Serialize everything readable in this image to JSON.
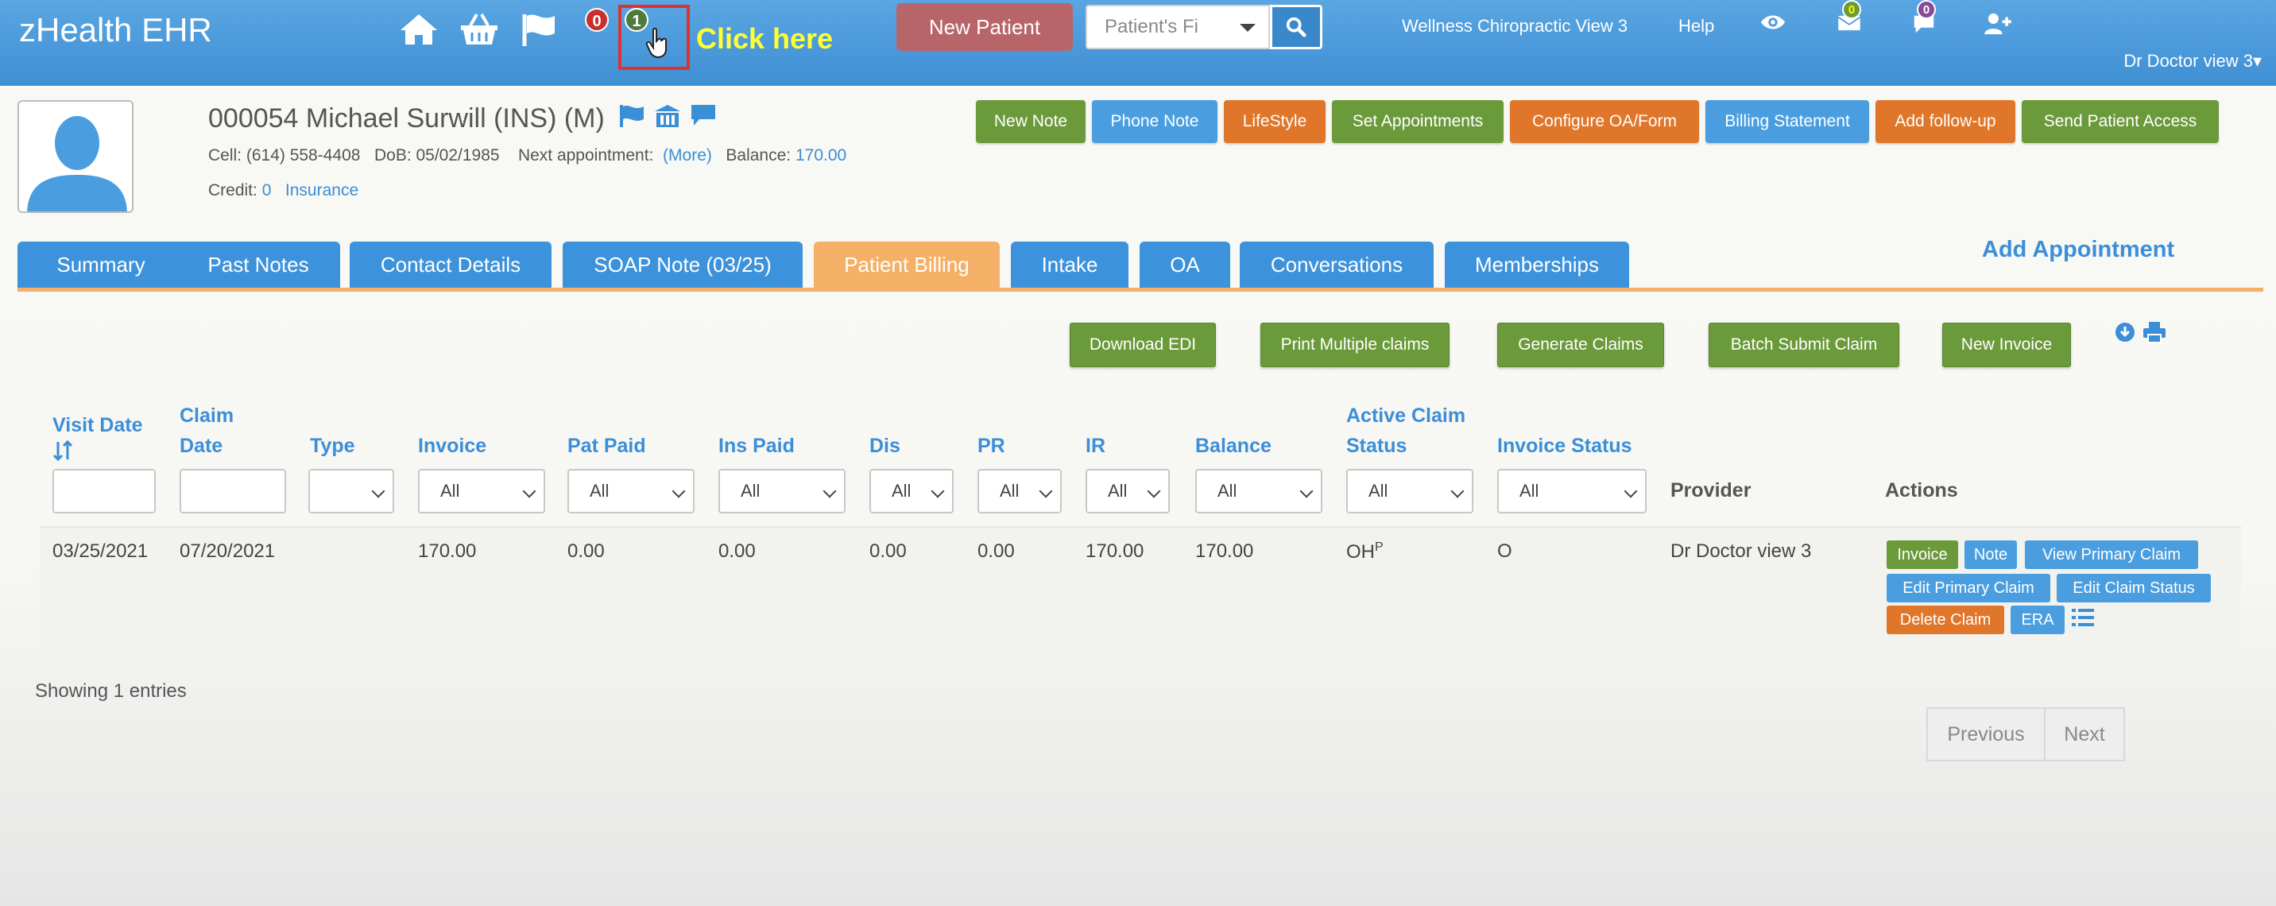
{
  "app": {
    "brand": "zHealth EHR",
    "notif_red_count": "0",
    "notif_green_count": "1",
    "click_hint": "Click here",
    "new_patient_label": "New Patient",
    "search_placeholder": "Patient's Fi",
    "clinic_name": "Wellness Chiropractic View 3",
    "help_label": "Help",
    "mail_count": "0",
    "chat_count": "0",
    "user_label": "Dr Doctor view 3",
    "user_caret": "▾"
  },
  "patient": {
    "title": "000054 Michael Surwill  (INS) (M)",
    "cell_label": "Cell: (614) 558-4408",
    "dob_label": "DoB: 05/02/1985",
    "next_appt_label": "Next appointment:",
    "next_appt_link": "(More)",
    "balance_label": "Balance:",
    "balance_value": "170.00",
    "credit_label": "Credit:",
    "credit_value": "0",
    "insurance_link": "Insurance"
  },
  "header_buttons": [
    "New Note",
    "Phone Note",
    "LifeStyle",
    "Set Appointments",
    "Configure OA/Form",
    "Billing Statement",
    "Add follow-up",
    "Send Patient Access"
  ],
  "tabs": [
    "Summary",
    "Past Notes",
    "Contact Details",
    "SOAP Note (03/25)",
    "Patient Billing",
    "Intake",
    "OA",
    "Conversations",
    "Memberships"
  ],
  "active_tab": "Patient Billing",
  "add_appointment": "Add Appointment",
  "billing_actions": [
    "Download EDI",
    "Print Multiple claims",
    "Generate Claims",
    "Batch Submit Claim",
    "New Invoice"
  ],
  "table": {
    "headers": {
      "visit_date": "Visit Date",
      "claim_date": [
        "Claim",
        "Date"
      ],
      "type": "Type",
      "invoice": "Invoice",
      "pat_paid": "Pat Paid",
      "ins_paid": "Ins Paid",
      "dis": "Dis",
      "pr": "PR",
      "ir": "IR",
      "balance": "Balance",
      "active_claim_status": [
        "Active Claim",
        "Status"
      ],
      "invoice_status": "Invoice Status",
      "provider": "Provider",
      "actions": "Actions"
    },
    "filter_all": "All",
    "row": {
      "visit_date": "03/25/2021",
      "claim_date": "07/20/2021",
      "type": "",
      "invoice": "170.00",
      "pat_paid": "0.00",
      "ins_paid": "0.00",
      "dis": "0.00",
      "pr": "0.00",
      "ir": "170.00",
      "balance": "170.00",
      "claim_status": "OH",
      "claim_status_sup": "P",
      "invoice_status": "O",
      "provider": "Dr Doctor view 3"
    },
    "row_actions": [
      "Invoice",
      "Note",
      "View Primary Claim",
      "Edit Primary Claim",
      "Edit Claim Status",
      "Delete Claim",
      "ERA"
    ]
  },
  "footer": {
    "showing": "Showing 1 entries",
    "previous": "Previous",
    "next": "Next"
  },
  "colors": {
    "nav_blue": "#4a9ae0",
    "button_green": "#6b9a3b",
    "button_blue": "#4a9ee0",
    "button_orange": "#e0762a",
    "active_tab": "#f5b067"
  }
}
